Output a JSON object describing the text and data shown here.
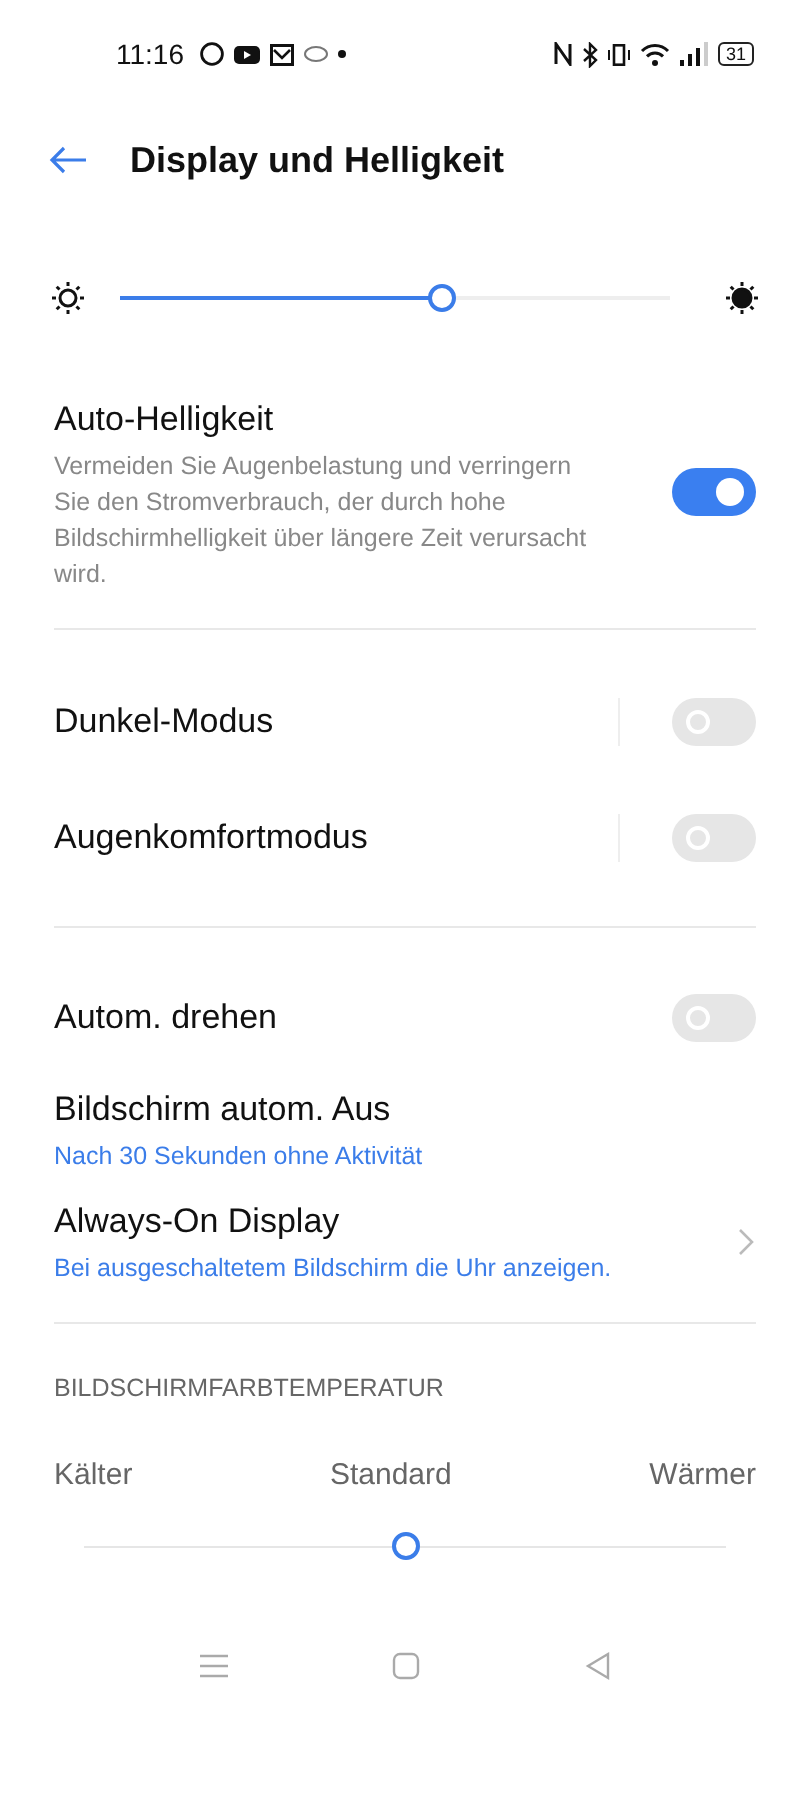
{
  "status_bar": {
    "time": "11:16",
    "battery": "31"
  },
  "header": {
    "title": "Display und Helligkeit"
  },
  "brightness": {
    "level": 0.585
  },
  "sections": [
    {
      "items": [
        {
          "kind": "toggle",
          "title": "Auto-Helligkeit",
          "description": "Vermeiden Sie Augenbelastung und verringern Sie den Stromverbrauch, der durch hohe Bildschirmhelligkeit über längere Zeit verursacht wird.",
          "on": true,
          "separated": false
        }
      ]
    },
    {
      "items": [
        {
          "kind": "toggle",
          "title": "Dunkel-Modus",
          "on": false,
          "separated": true
        },
        {
          "kind": "toggle",
          "title": "Augenkomfortmodus",
          "on": false,
          "separated": true
        }
      ]
    },
    {
      "items": [
        {
          "kind": "toggle",
          "title": "Autom. drehen",
          "on": false,
          "separated": false
        },
        {
          "kind": "value",
          "title": "Bildschirm autom. Aus",
          "value": "Nach 30 Sekunden ohne Aktivität"
        },
        {
          "kind": "link",
          "title": "Always-On Display",
          "value": "Bei ausgeschaltetem Bildschirm die Uhr anzeigen."
        }
      ]
    }
  ],
  "color_temperature": {
    "heading": "BILDSCHIRMFARBTEMPERATUR",
    "labels": [
      "Kälter",
      "Standard",
      "Wärmer"
    ],
    "level": 0.5
  }
}
